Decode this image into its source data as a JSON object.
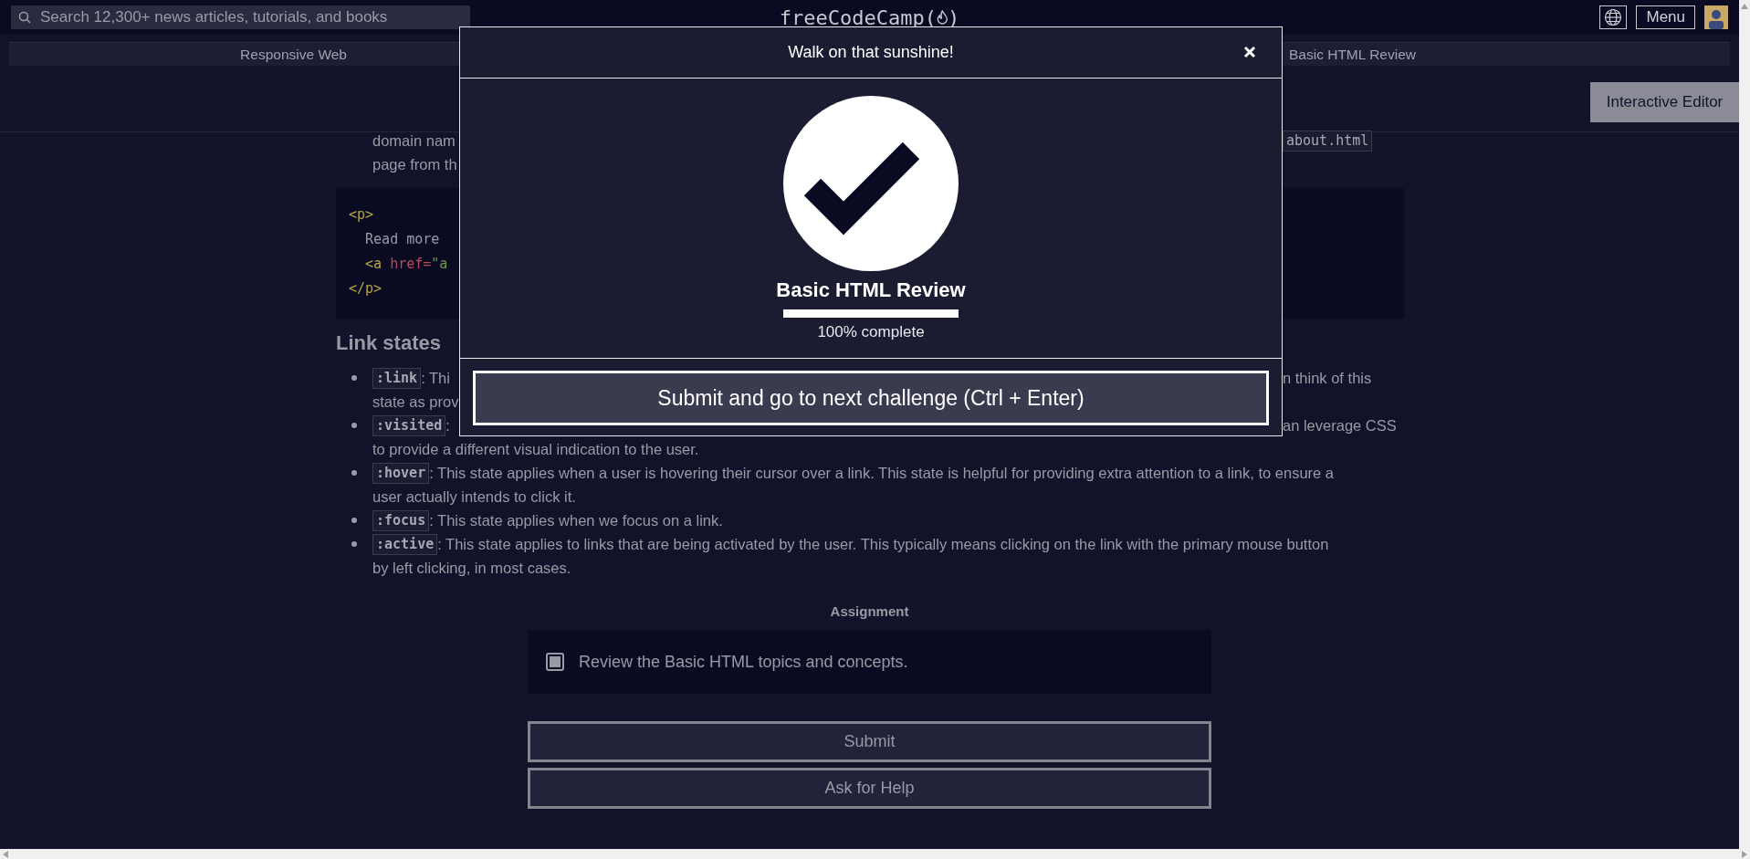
{
  "nav": {
    "search": {
      "placeholder": "Search 12,300+ news articles, tutorials, and books"
    },
    "logo": {
      "text": "freeCodeCamp",
      "open": "(",
      "close": ")"
    },
    "menu_button": "Menu"
  },
  "breadcrumb": {
    "left": "Responsive Web",
    "right": "Basic HTML Review"
  },
  "editor_button": "Interactive Editor",
  "content": {
    "intro_lines": [
      {
        "left": "domain nam",
        "right_code": "about.html"
      },
      {
        "left": "page from th"
      }
    ],
    "code_block": [
      [
        {
          "kind": "tag",
          "text": "<p>"
        }
      ],
      [
        {
          "kind": "text",
          "text": "  Read more"
        }
      ],
      [
        {
          "kind": "tag",
          "text": "  <a"
        },
        {
          "kind": "attr",
          "text": " href"
        },
        {
          "kind": "attr",
          "text": "="
        },
        {
          "kind": "string",
          "text": "\"a"
        }
      ],
      [
        {
          "kind": "tag",
          "text": "</p>"
        }
      ]
    ],
    "heading": "Link states",
    "list": [
      {
        "code": ":link",
        "lines": [
          {
            "left": ": Thi",
            "right": "n think of this"
          },
          {
            "left": "state as prov"
          }
        ]
      },
      {
        "code": ":visited",
        "lines": [
          {
            "left": ":",
            "right": "an leverage CSS"
          },
          {
            "text": "to provide a different visual indication to the user."
          }
        ]
      },
      {
        "code": ":hover",
        "lines": [
          {
            "text": ": This state applies when a user is hovering their cursor over a link. This state is helpful for providing extra attention to a link, to ensure a"
          },
          {
            "text": "user actually intends to click it."
          }
        ]
      },
      {
        "code": ":focus",
        "lines": [
          {
            "text": ": This state applies when we focus on a link."
          }
        ]
      },
      {
        "code": ":active",
        "lines": [
          {
            "text": ": This state applies to links that are being activated by the user. This typically means clicking on the link with the primary mouse button"
          },
          {
            "text": "by left clicking, in most cases."
          }
        ]
      }
    ]
  },
  "assignment": {
    "title": "Assignment",
    "tasks": [
      {
        "text": "Review the Basic HTML topics and concepts.",
        "checked": true
      }
    ]
  },
  "buttons": [
    "Submit",
    "Ask for Help"
  ],
  "modal": {
    "title": "Walk on that sunshine!",
    "block_title": "Basic HTML Review",
    "level": 1,
    "progress_text": "100% complete",
    "button": "Submit and go to next challenge (Ctrl + Enter)"
  }
}
